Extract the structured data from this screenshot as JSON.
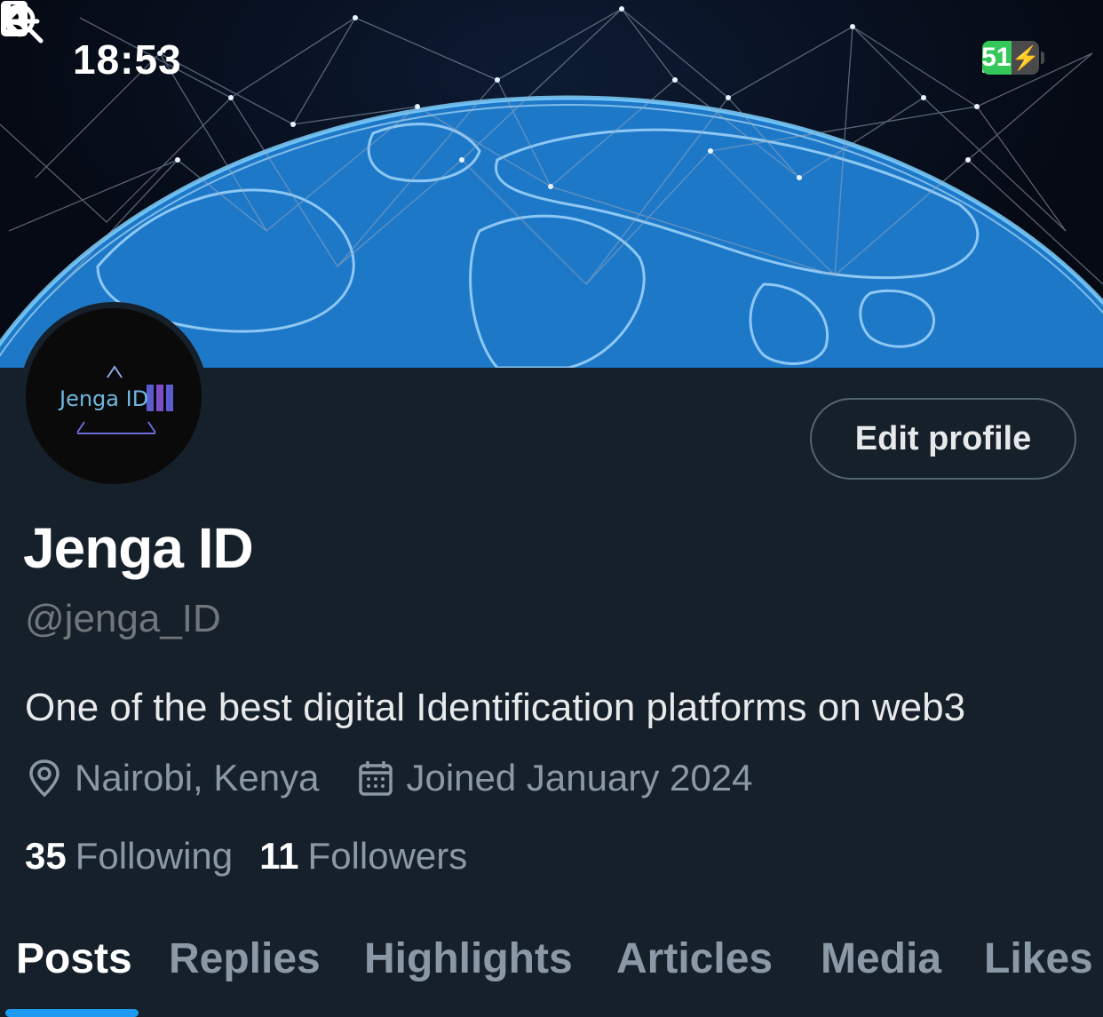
{
  "status_bar": {
    "time": "18:53",
    "battery_level": "51",
    "icons": [
      "id-card-icon",
      "signal-icon",
      "wifi-icon",
      "battery-charging-icon"
    ]
  },
  "header": {
    "back_icon": "arrow-left-icon",
    "search_icon": "search-icon"
  },
  "profile": {
    "avatar_text": "Jenga ID",
    "edit_label": "Edit profile",
    "display_name": "Jenga ID",
    "handle": "@jenga_ID",
    "bio": "One of the best digital Identification platforms on web3",
    "location": "Nairobi, Kenya",
    "joined": "Joined January 2024",
    "following_count": "35",
    "following_label": "Following",
    "followers_count": "11",
    "followers_label": "Followers"
  },
  "tabs": [
    {
      "label": "Posts",
      "active": true
    },
    {
      "label": "Replies",
      "active": false
    },
    {
      "label": "Highlights",
      "active": false
    },
    {
      "label": "Articles",
      "active": false
    },
    {
      "label": "Media",
      "active": false
    },
    {
      "label": "Likes",
      "active": false
    }
  ],
  "colors": {
    "background": "#15202b",
    "accent": "#1d9bf0",
    "muted_text": "#8b98a5",
    "battery_green": "#34c759"
  }
}
